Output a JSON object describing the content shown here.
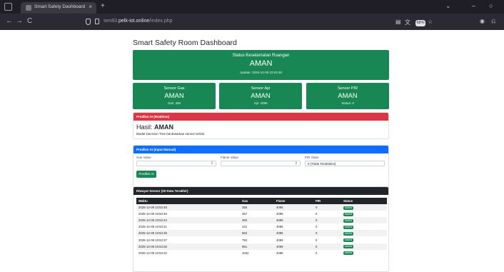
{
  "browser": {
    "tab_title": "Smart Safety Dashboard",
    "tab_close": "×",
    "new_tab": "+",
    "url_prefix": "sen83.",
    "url_domain": "pelk-iot.online",
    "url_path": "/index.php",
    "zoom": "68%",
    "nav_back": "←",
    "nav_forward": "→",
    "nav_reload": "C",
    "minimize": "–",
    "dropdown": "⌄",
    "restore": "○"
  },
  "page": {
    "title": "Smart Safety Room Dashboard"
  },
  "status": {
    "label": "Status Keselamatan Ruangan",
    "value": "AMAN",
    "updated": "Update: 2025-12-08 10:53:48",
    "color": "#198754"
  },
  "sensors": [
    {
      "label": "Sensor Gas",
      "value": "AMAN",
      "sub": "Gas: 380"
    },
    {
      "label": "Sensor Api",
      "value": "AMAN",
      "sub": "Api: 4095"
    },
    {
      "label": "Sensor PIR",
      "value": "AMAN",
      "sub": "Status: 0"
    }
  ],
  "ai_prediction": {
    "header": "Prediksi AI (Realtime)",
    "result_label": "Hasil:",
    "result_value": "AMAN",
    "description": "Model Decision Tree berdasarkan sensor terkini.",
    "header_color": "#dc3545"
  },
  "manual": {
    "header": "Prediksi AI (Input Manual)",
    "gas_label": "Gas Value",
    "flame_label": "Flame Value",
    "pir_label": "PIR State",
    "pir_selected": "0 (Tidak Terdeteksi)",
    "spinner": "⇕",
    "button": "Prediksi AI",
    "header_color": "#0d6efd"
  },
  "history": {
    "header": "Riwayat Sensor (20 Data Terakhir)",
    "columns": [
      "Waktu",
      "Gas",
      "Flame",
      "PIR",
      "Status"
    ],
    "rows": [
      [
        "2025-12-08 10:53:48",
        "358",
        "4095",
        "0",
        "AMAN"
      ],
      [
        "2025-12-08 10:53:46",
        "357",
        "4095",
        "0",
        "AMAN"
      ],
      [
        "2025-12-08 10:53:43",
        "383",
        "4095",
        "0",
        "AMAN"
      ],
      [
        "2025-12-08 10:53:41",
        "441",
        "4095",
        "0",
        "AMAN"
      ],
      [
        "2025-12-08 10:53:39",
        "563",
        "4095",
        "0",
        "AMAN"
      ],
      [
        "2025-12-08 10:53:37",
        "753",
        "4095",
        "0",
        "AMAN"
      ],
      [
        "2025-12-08 10:53:35",
        "961",
        "4095",
        "0",
        "AMAN"
      ],
      [
        "2025-12-08 10:53:32",
        "1032",
        "4095",
        "0",
        "AMAN"
      ]
    ]
  }
}
